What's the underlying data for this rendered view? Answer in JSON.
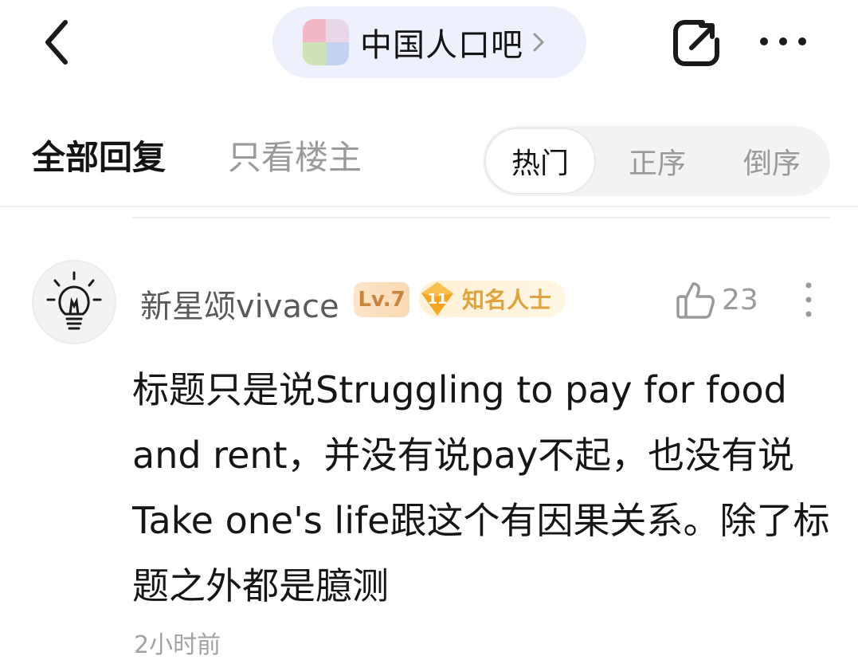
{
  "header": {
    "forum_name": "中国人口吧",
    "icons": {
      "back": "chevron-left-icon",
      "forum_chevron": "chevron-right-icon",
      "share": "share-icon",
      "more": "more-horizontal-icon"
    }
  },
  "tabs": {
    "all_replies": "全部回复",
    "op_only": "只看楼主"
  },
  "sort": {
    "options": [
      "热门",
      "正序",
      "倒序"
    ],
    "selected": "热门"
  },
  "comment": {
    "username": "新星颂vivace",
    "level": "Lv.7",
    "honor_level": "11",
    "honor_title": "知名人士",
    "like_count": "23",
    "text": "标题只是说Struggling to pay for food and rent，并没有说pay不起，也没有说Take one's life跟这个有因果关系。除了标题之外都是臆测",
    "time": "2小时前",
    "avatar_icon": "lightbulb-icon"
  },
  "colors": {
    "pill_bg": "#eef0fb",
    "sort_bg": "#f3f3f5",
    "level_text": "#c8853d",
    "honor_text": "#e0a23a",
    "muted": "#9a9a9a"
  }
}
